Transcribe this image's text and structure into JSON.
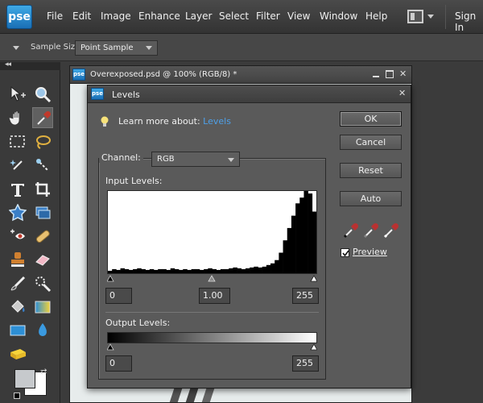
{
  "menubar": {
    "logo": "pse",
    "items": [
      "File",
      "Edit",
      "Image",
      "Enhance",
      "Layer",
      "Select",
      "Filter",
      "View",
      "Window",
      "Help"
    ],
    "sign_in": "Sign In"
  },
  "options": {
    "sample_size_label": "Sample Size:",
    "sample_size_value": "Point Sample"
  },
  "document": {
    "icon_text": "pse",
    "title": "Overexposed.psd @ 100% (RGB/8) *"
  },
  "levels": {
    "icon_text": "pse",
    "title": "Levels",
    "learn_more_prefix": "Learn more about: ",
    "learn_more_link": "Levels",
    "channel_label": "Channel:",
    "channel_value": "RGB",
    "input_levels_label": "Input Levels:",
    "input_black": "0",
    "input_gamma": "1.00",
    "input_white": "255",
    "output_levels_label": "Output Levels:",
    "output_black": "0",
    "output_white": "255",
    "buttons": {
      "ok": "OK",
      "cancel": "Cancel",
      "reset": "Reset",
      "auto": "Auto"
    },
    "preview_label": "Preview",
    "preview_checked": true
  },
  "colors": {
    "accent_link": "#4ea0e8",
    "dialog_bg": "#5a5a5a",
    "pse_blue": "#1a6fb5",
    "foreground_swatch": "#c6c9cc",
    "background_swatch": "#ffffff"
  },
  "histogram_shape": [
    0.03,
    0.05,
    0.04,
    0.06,
    0.05,
    0.04,
    0.05,
    0.06,
    0.05,
    0.04,
    0.05,
    0.04,
    0.05,
    0.05,
    0.04,
    0.06,
    0.05,
    0.04,
    0.05,
    0.04,
    0.05,
    0.05,
    0.04,
    0.05,
    0.06,
    0.05,
    0.04,
    0.05,
    0.05,
    0.06,
    0.07,
    0.06,
    0.05,
    0.06,
    0.07,
    0.08,
    0.07,
    0.08,
    0.1,
    0.12,
    0.16,
    0.25,
    0.4,
    0.55,
    0.7,
    0.85,
    0.92,
    1.0,
    0.97,
    0.75
  ]
}
